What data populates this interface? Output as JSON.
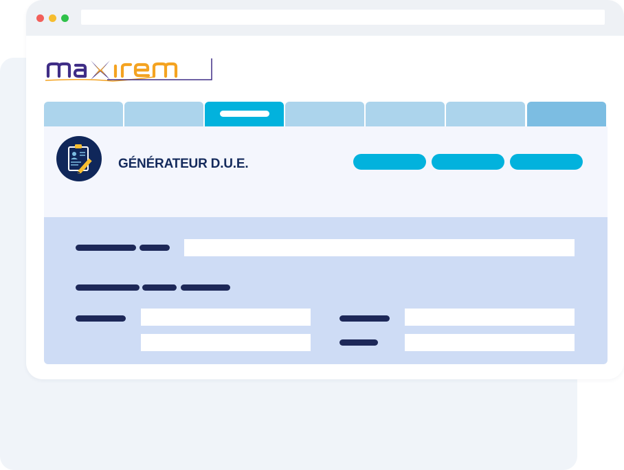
{
  "header": {
    "title": "GÉNÉRATEUR D.U.E."
  },
  "colors": {
    "chrome": "#eef1f5",
    "dot_red": "#f25f5a",
    "dot_yellow": "#f6bd2f",
    "dot_green": "#2fc14a",
    "tab": "#acd4ec",
    "tab_active": "#02b2dd",
    "tab_last": "#7cbde2",
    "button": "#02b2dd",
    "navy": "#10275a",
    "logo_purple": "#3f2d86",
    "logo_orange": "#f4a321"
  },
  "icons": {
    "badge": "clipboard-pencil-icon",
    "logo_cross": "star-cross-icon"
  }
}
